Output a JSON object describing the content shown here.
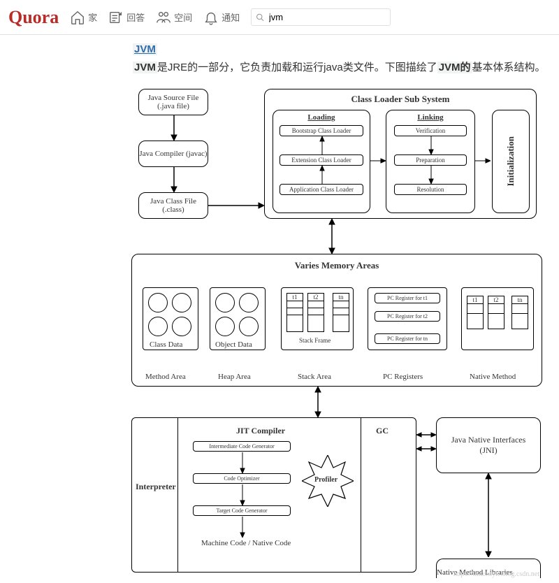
{
  "header": {
    "logo": "Quora",
    "nav": {
      "home": "家",
      "answer": "回答",
      "spaces": "空间",
      "notify": "通知"
    },
    "search": {
      "value": "jvm"
    }
  },
  "post": {
    "title": "JVM",
    "bold1": "JVM",
    "text1": "是JRE的一部分，它负责加载和运行java类文件。下图描绘了",
    "bold2": "JVM的",
    "text2": "基本体系结构。"
  },
  "diagram": {
    "src1": "Java Source File\n(.java file)",
    "src2": "Java Compiler\n(javac)",
    "src3": "Java Class File\n(.class)",
    "cls_title": "Class Loader Sub System",
    "loading": "Loading",
    "linking": "Linking",
    "init": "Initialization",
    "boot": "Bootstrap Class Loader",
    "ext": "Extension Class Loader",
    "app": "Application Class Loader",
    "verif": "Verification",
    "prep": "Preparation",
    "resol": "Resolution",
    "mem_title": "Varies Memory Areas",
    "class_data": "Class Data",
    "object_data": "Object Data",
    "t1": "t1",
    "t2": "t2",
    "tn": "tn",
    "stack_frame": "Stack Frame",
    "pc1": "PC Register for t1",
    "pc2": "PC Register for t2",
    "pcn": "PC Register for tn",
    "method_area": "Method Area",
    "heap_area": "Heap Area",
    "stack_area": "Stack Area",
    "pc_reg": "PC Registers",
    "native_method": "Native Method",
    "interpreter": "Interpreter",
    "jit": "JIT Compiler",
    "icg": "Intermediate Code Generator",
    "opt": "Code Optimizer",
    "tcg": "Target Code Generator",
    "profiler": "Profiler",
    "machine": "Machine Code / Native Code",
    "gc": "GC",
    "jni": "Java Native Interfaces\n(JNI)",
    "nml": "Native Method Libraries"
  },
  "watermark": "https://linuxstyle.blog.csdn.net"
}
